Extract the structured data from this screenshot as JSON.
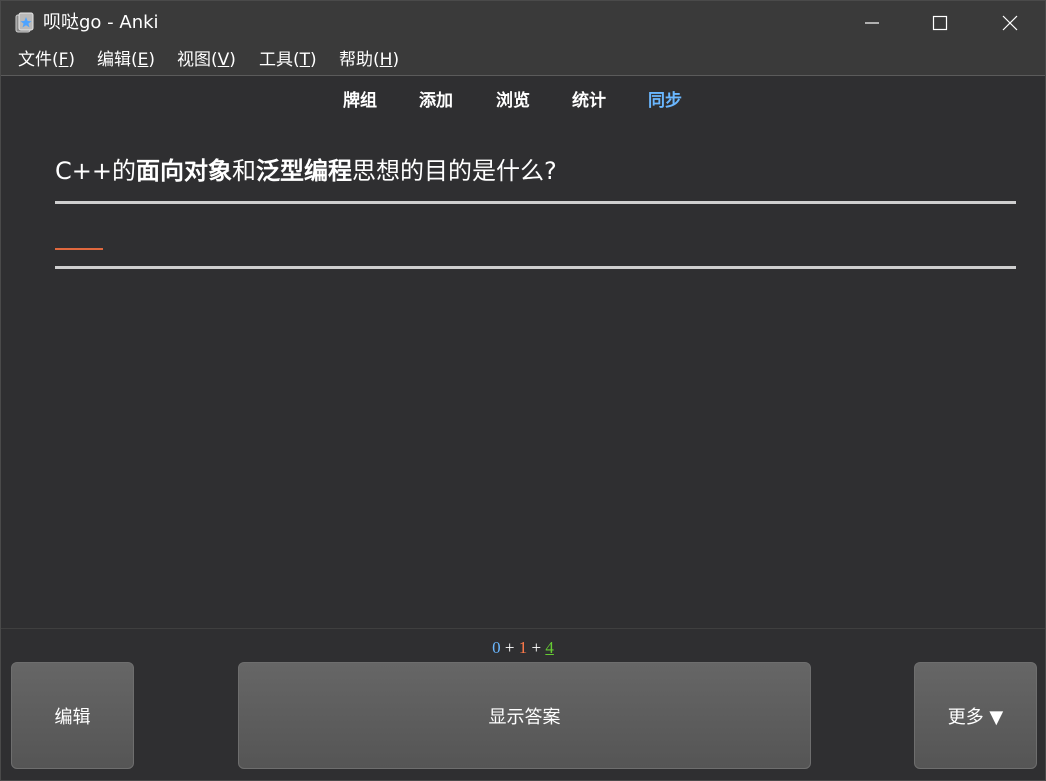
{
  "window": {
    "title": "呗哒go - Anki",
    "app_icon": "anki-star-icon"
  },
  "menu": {
    "items": [
      {
        "label": "文件(",
        "key": "F",
        "tail": ")"
      },
      {
        "label": "编辑(",
        "key": "E",
        "tail": ")"
      },
      {
        "label": "视图(",
        "key": "V",
        "tail": ")"
      },
      {
        "label": "工具(",
        "key": "T",
        "tail": ")"
      },
      {
        "label": "帮助(",
        "key": "H",
        "tail": ")"
      }
    ]
  },
  "nav": {
    "decks": "牌组",
    "add": "添加",
    "browse": "浏览",
    "stats": "统计",
    "sync": "同步",
    "sync_color": "#6ab7ff"
  },
  "card": {
    "q_part1": "C++的",
    "q_bold1": "面向对象",
    "q_part2": "和",
    "q_bold2": "泛型编程",
    "q_part3": "思想的目的是什么?",
    "cloze_color": "#e0683e"
  },
  "bottom": {
    "count_new": "0",
    "plus1": " + ",
    "count_learn": "1",
    "plus2": " + ",
    "count_review": "4",
    "edit_label": "编辑",
    "show_answer_label": "显示答案",
    "more_label": "更多 ▼"
  }
}
